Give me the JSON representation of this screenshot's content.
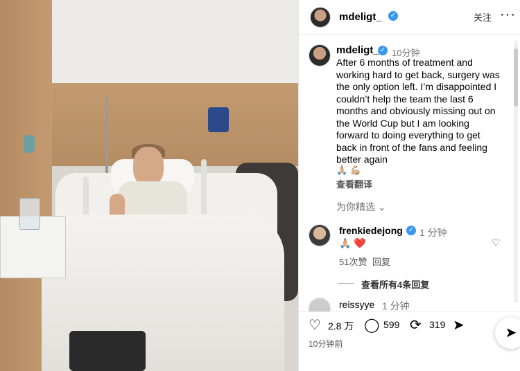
{
  "post": {
    "username": "mdeligt_",
    "follow_label": "关注",
    "more_label": "···",
    "caption_user": "mdeligt_",
    "caption_time": "10分钟",
    "caption_text": "After 6 months of treatment and working hard to get back, surgery was the only option left. I’m disappointed I couldn’t help the team the last 6 months and obviously missing out on the World Cup but I am looking forward to doing everything to get back in front of the fans and feeling better again",
    "caption_emojis": "🙏🏼 💪🏼",
    "translate_label": "查看翻译",
    "for_you_label": "为你精选",
    "for_you_chevron": "⌄"
  },
  "comments": [
    {
      "user": "frenkiedejong",
      "time": "1 分钟",
      "text": "🙏🏼 ❤️",
      "likes": "51次赞",
      "reply_label": "回复",
      "view_replies": "查看所有4条回复"
    },
    {
      "user": "reissyye",
      "time": "1 分钟"
    }
  ],
  "actions": {
    "likes": "2.8 万",
    "comments": "599",
    "reposts": "319",
    "posted_time": "10分钟前"
  },
  "icons": {
    "heart": "heart-icon",
    "comment": "comment-icon",
    "repost": "repost-icon",
    "share": "send-icon",
    "verified": "verified-badge-icon",
    "chevron": "chevron-down-icon"
  },
  "colors": {
    "verified_blue": "#3897f0",
    "heart_red": "#ed4956",
    "muted_text": "#737373"
  }
}
